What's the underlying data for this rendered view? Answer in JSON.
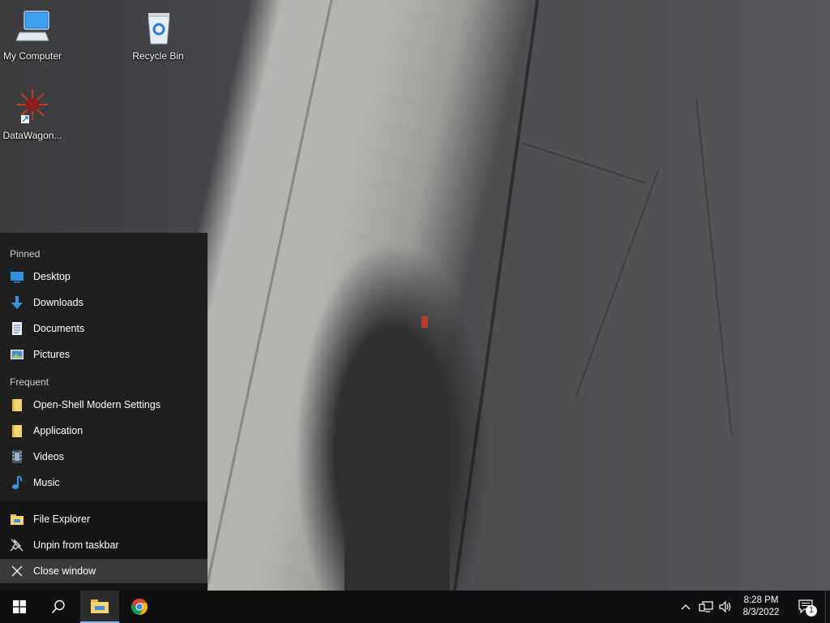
{
  "desktop_icons": {
    "my_computer": "My Computer",
    "recycle_bin": "Recycle Bin",
    "datawagon": "DataWagon..."
  },
  "jumplist": {
    "pinned_title": "Pinned",
    "pinned": [
      {
        "label": "Desktop",
        "icon": "desktop-icon"
      },
      {
        "label": "Downloads",
        "icon": "downloads-icon"
      },
      {
        "label": "Documents",
        "icon": "documents-icon"
      },
      {
        "label": "Pictures",
        "icon": "pictures-icon"
      }
    ],
    "frequent_title": "Frequent",
    "frequent": [
      {
        "label": "Open-Shell Modern Settings",
        "icon": "folder-icon"
      },
      {
        "label": "Application",
        "icon": "folder-icon"
      },
      {
        "label": "Videos",
        "icon": "videos-icon"
      },
      {
        "label": "Music",
        "icon": "music-icon"
      }
    ],
    "tasks": [
      {
        "label": "File Explorer",
        "icon": "file-explorer-icon"
      },
      {
        "label": "Unpin from taskbar",
        "icon": "unpin-icon"
      },
      {
        "label": "Close window",
        "icon": "close-icon"
      }
    ]
  },
  "taskbar": {
    "time": "8:28 PM",
    "date": "8/3/2022",
    "notification_count": "1",
    "accent_color": "#7fb2e5"
  }
}
